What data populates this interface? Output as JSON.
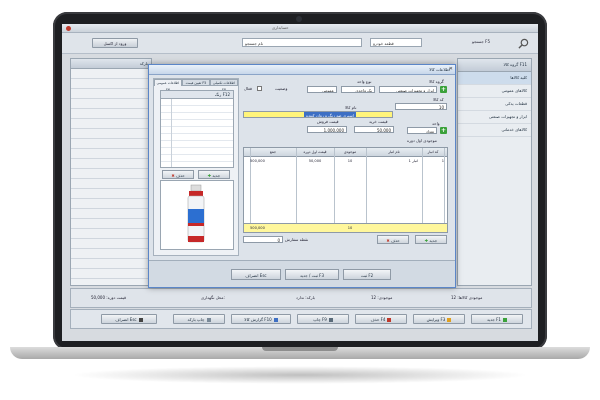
{
  "window": {
    "title": "حسابداری"
  },
  "toolbar": {
    "search_label": "جستجو F5",
    "group_field": "قطعه خودرو",
    "name_field": "نام جستجو",
    "import_btn": "ورود از اکسل"
  },
  "left_grid": {
    "header": "بارکد"
  },
  "categories": {
    "header": "گروه کالا F11",
    "items": [
      "کلیه کالاها",
      "کالاهای عمومی",
      "قطعات یدکی",
      "ابزار و تجهیزات صنعتی",
      "کالاهای خدماتی"
    ]
  },
  "status": {
    "count_label": "موجودی کالاها: 12",
    "stock_label": "موجودی: 12",
    "code_label": "بارکد: ندارد",
    "place_label": "محل نگهداری:",
    "sum_label": "قیمت دوره: 50,000"
  },
  "footbar": {
    "new": "جدید F1",
    "edit": "ویرایش F3",
    "delete": "حذف F4",
    "print": "چاپ F9",
    "report": "گزارش کالا F10",
    "priceprint": "چاپ بارکد",
    "close": "انصراف Esc"
  },
  "dialog": {
    "title": "اطلاعات کالا",
    "tabs": [
      "اطلاعات عمومی F6",
      "تعیین قیمت F5",
      "اطلاعات تکمیلی F8"
    ],
    "color_list_header": "رنگ F12",
    "color_new": "جدید",
    "color_delete": "حذف",
    "labels": {
      "group": "گروه کالا",
      "unit": "نوع واحد",
      "status": "وضعیت",
      "active": "فعال",
      "code": "کد کالا",
      "name": "نام کالا",
      "buy": "قیمت خرید",
      "sell": "قیمت فروش",
      "unit2": "واحد",
      "period": "موجودی اول دوره",
      "order_point": "نقطه سفارش"
    },
    "values": {
      "group": "ابزار و تجهیزات صنعتی",
      "unit": "یک واحدی",
      "type": "عمومی",
      "code": "10",
      "name": "اسپری ضد زنگ و روان کننده",
      "buy": "50,000",
      "sell": "1,000,000",
      "unit2": "تعداد",
      "order_point": "0"
    },
    "table": {
      "headers": [
        "کد انبار",
        "نام انبار",
        "موجودی",
        "قیمت اول دوره",
        "جمع"
      ],
      "row": [
        "1",
        "انبار 1",
        "10",
        "50,000",
        "500,000"
      ],
      "footer": [
        "10",
        "500,000"
      ]
    },
    "table_new": "جدید",
    "table_delete": "حذف",
    "btn_save": "ثبت F2",
    "btn_save_new": "ثبت / جدید F3",
    "btn_cancel": "انصراف Esc"
  },
  "colors": {
    "accent": "#3d6fc4",
    "highlight": "#fff47a",
    "plus": "#3aa13a",
    "danger": "#c0392b"
  }
}
